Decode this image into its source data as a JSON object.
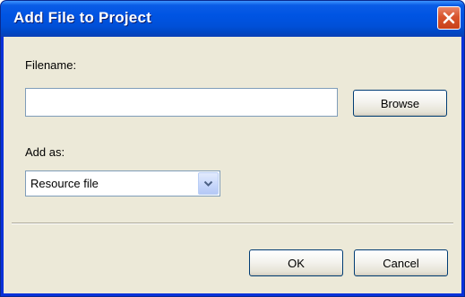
{
  "window": {
    "title": "Add File to Project"
  },
  "form": {
    "filename_label": "Filename:",
    "filename_value": "",
    "browse_label": "Browse",
    "add_as_label": "Add as:",
    "add_as_selected": "Resource file"
  },
  "footer": {
    "ok_label": "OK",
    "cancel_label": "Cancel"
  },
  "icons": {
    "close": "close-icon",
    "dropdown": "chevron-down-icon"
  },
  "colors": {
    "titlebar": "#0054e3",
    "close_button": "#d8542c",
    "dialog_background": "#ece9d8",
    "field_border": "#7f9db9",
    "button_border": "#003c74"
  }
}
